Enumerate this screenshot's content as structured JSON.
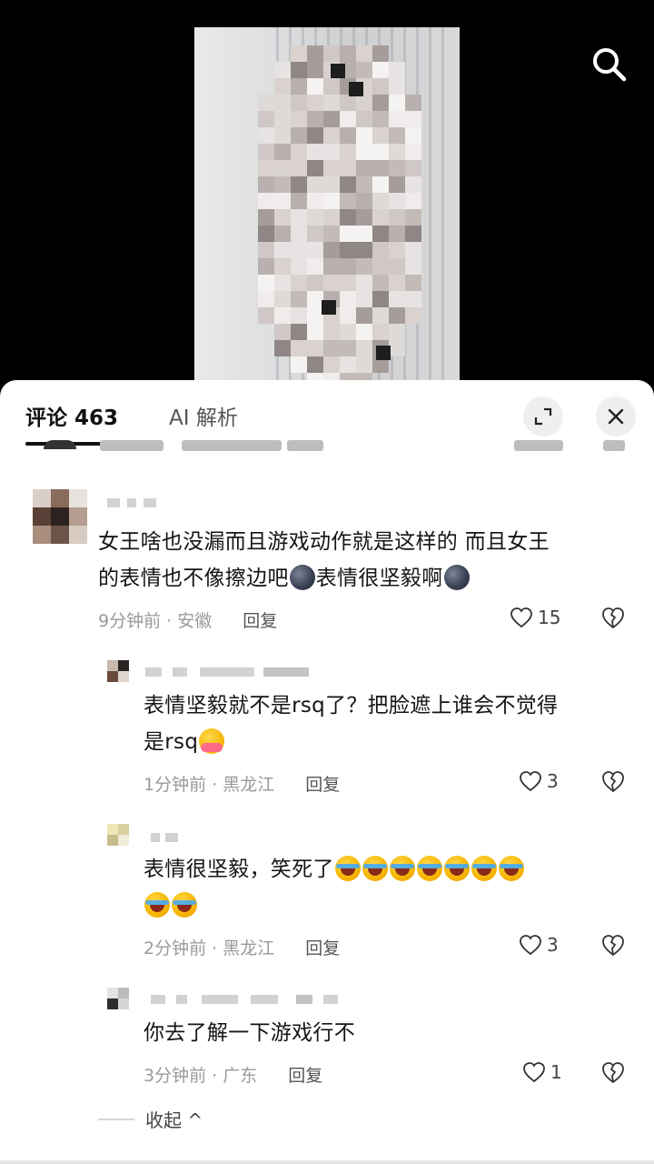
{
  "header": {
    "comments_tab": "评论 463",
    "ai_tab": "AI 解析"
  },
  "icons": {
    "search": "search-icon",
    "expand": "expand-icon",
    "close": "close-icon",
    "like": "heart-icon",
    "dislike": "broken-heart-icon"
  },
  "comments": [
    {
      "text_a": "女王啥也没漏而且游戏动作就是这样的 而且女王",
      "text_b": "的表情也不像擦边吧",
      "text_c": "表情很坚毅啊",
      "time": "9分钟前 · 安徽",
      "reply": "回复",
      "likes": "15"
    },
    {
      "text_a": "表情坚毅就不是rsq了？把脸遮上谁会不觉得",
      "text_b": "是rsq",
      "time": "1分钟前 · 黑龙江",
      "reply": "回复",
      "likes": "3"
    },
    {
      "text_a": "表情很坚毅，笑死了",
      "time": "2分钟前 · 黑龙江",
      "reply": "回复",
      "likes": "3"
    },
    {
      "text_a": "你去了解一下游戏行不",
      "time": "3分钟前 · 广东",
      "reply": "回复",
      "likes": "1"
    }
  ],
  "collapse_label": "收起 ^"
}
